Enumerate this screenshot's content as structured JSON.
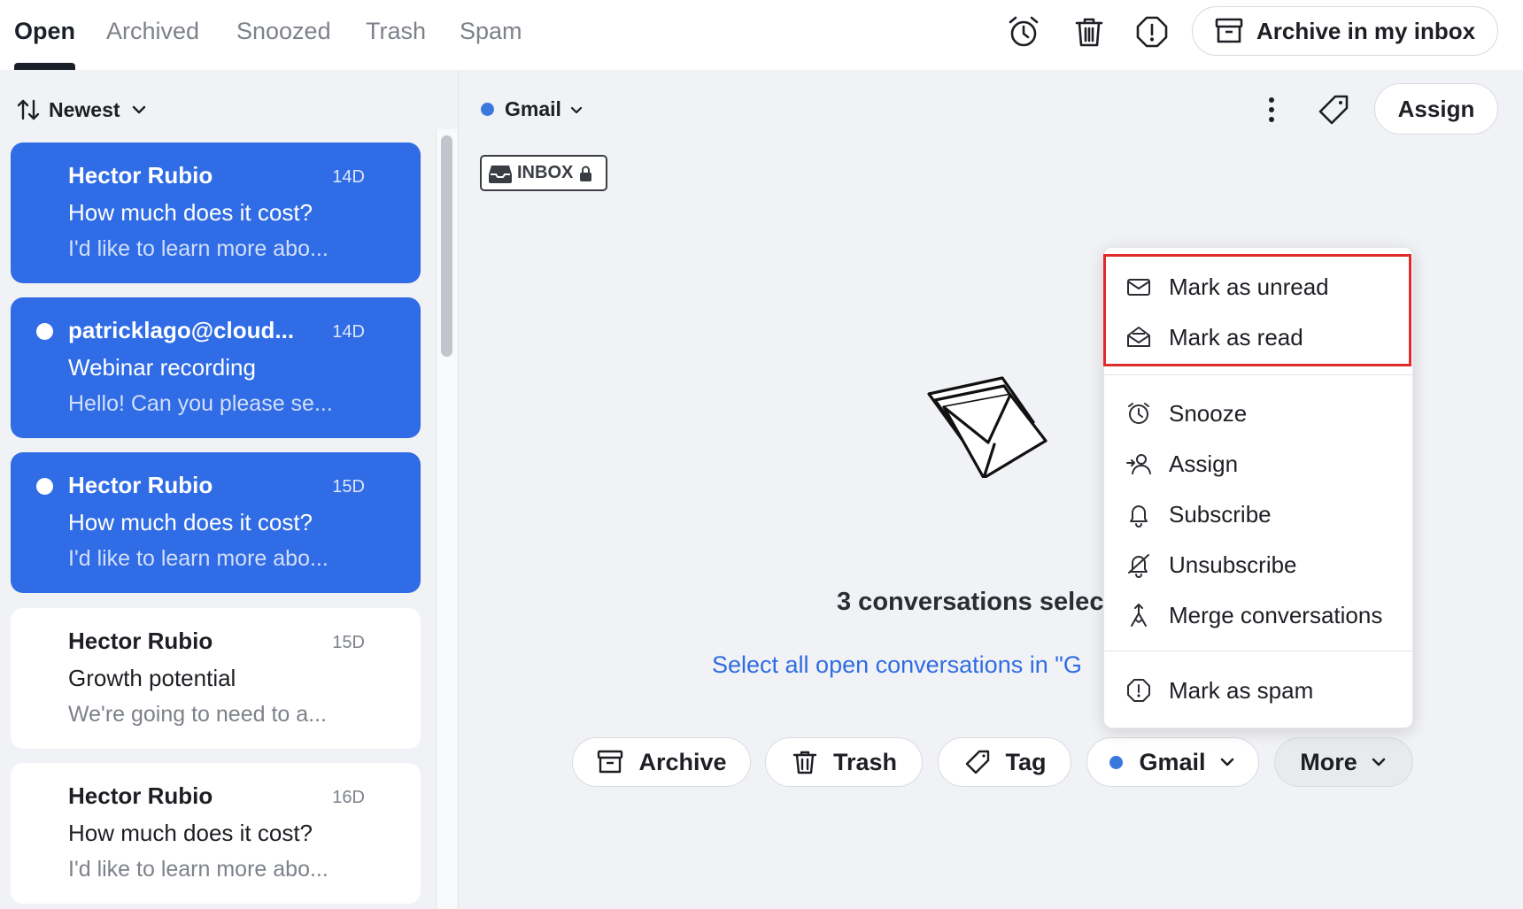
{
  "tabs": [
    {
      "label": "Open",
      "active": true
    },
    {
      "label": "Archived",
      "active": false
    },
    {
      "label": "Snoozed",
      "active": false
    },
    {
      "label": "Trash",
      "active": false
    },
    {
      "label": "Spam",
      "active": false
    }
  ],
  "toolbar": {
    "icons": [
      "alarm-clock-icon",
      "trash-icon",
      "alert-shield-icon"
    ],
    "archive_inbox_label": "Archive in my inbox"
  },
  "list": {
    "sort_label": "Newest",
    "conversations": [
      {
        "sender": "Hector Rubio",
        "time": "14D",
        "subject": "How much does it cost?",
        "preview": "I'd like to learn more abo...",
        "selected": true,
        "unread": false
      },
      {
        "sender": "patricklago@cloud...",
        "time": "14D",
        "subject": "Webinar recording",
        "preview": "Hello! Can you please se...",
        "selected": true,
        "unread": true
      },
      {
        "sender": "Hector Rubio",
        "time": "15D",
        "subject": "How much does it cost?",
        "preview": "I'd like to learn more abo...",
        "selected": true,
        "unread": true
      },
      {
        "sender": "Hector Rubio",
        "time": "15D",
        "subject": "Growth potential",
        "preview": "We're going to need to a...",
        "selected": false,
        "unread": false
      },
      {
        "sender": "Hector Rubio",
        "time": "16D",
        "subject": "How much does it cost?",
        "preview": "I'd like to learn more abo...",
        "selected": false,
        "unread": false
      }
    ]
  },
  "main": {
    "inbox_name": "Gmail",
    "assign_label": "Assign",
    "badge_label": "INBOX",
    "selected_count_text": "3 conversations selec",
    "select_all_link": "Select all open conversations in \"G"
  },
  "actions": {
    "archive": "Archive",
    "trash": "Trash",
    "tag": "Tag",
    "inbox": "Gmail",
    "more": "More"
  },
  "menu": {
    "items": [
      {
        "label": "Mark as unread",
        "icon": "envelope-closed-icon"
      },
      {
        "label": "Mark as read",
        "icon": "envelope-open-icon"
      },
      {
        "label": "Snooze",
        "icon": "alarm-clock-icon"
      },
      {
        "label": "Assign",
        "icon": "assign-user-icon"
      },
      {
        "label": "Subscribe",
        "icon": "bell-icon"
      },
      {
        "label": "Unsubscribe",
        "icon": "bell-off-icon"
      },
      {
        "label": "Merge conversations",
        "icon": "merge-icon"
      },
      {
        "label": "Mark as spam",
        "icon": "alert-shield-icon"
      }
    ]
  },
  "colors": {
    "accent": "#2f6ce5",
    "highlight": "#e02b2b",
    "inbox_dot": "#3b78de"
  }
}
